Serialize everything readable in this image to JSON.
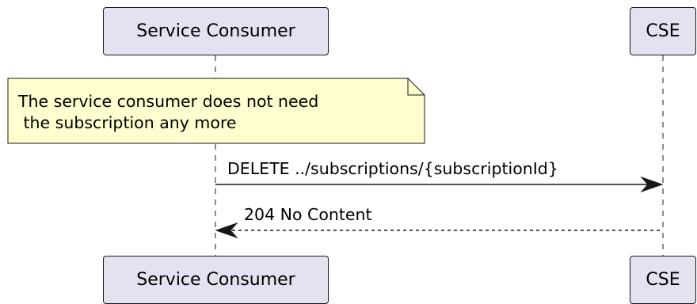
{
  "participants": {
    "consumer": "Service Consumer",
    "cse": "CSE"
  },
  "note": {
    "line1": "The service consumer does not need",
    "line2": " the subscription any more"
  },
  "messages": [
    {
      "label": "DELETE ../subscriptions/{subscriptionId}",
      "style": "solid"
    },
    {
      "label": "204 No Content",
      "style": "dashed"
    }
  ],
  "colors": {
    "participant_fill": "#e2e2f0",
    "note_fill": "#fefece",
    "line": "#181818"
  }
}
